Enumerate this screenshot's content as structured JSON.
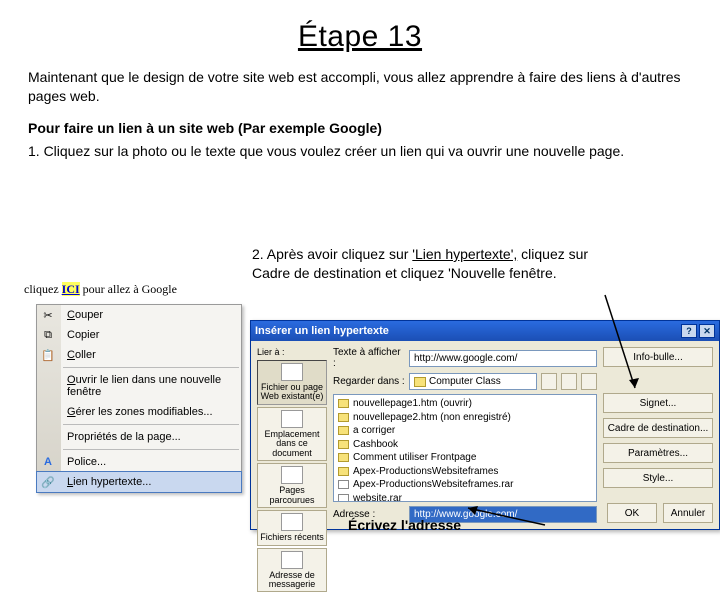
{
  "title": "Étape 13",
  "intro": "Maintenant que le design de votre site web est accompli, vous allez apprendre à faire des liens à d'autres pages web.",
  "subhead": "Pour faire un lien à un site web (Par exemple Google)",
  "step1": "1. Cliquez sur la photo ou le texte que vous voulez créer un lien qui va ouvrir une nouvelle page.",
  "step2_pre": "2. Après avoir cliquez sur ",
  "step2_link": "'Lien hypertexte',",
  "step2_post": " cliquez sur Cadre de destination et cliquez 'Nouvelle fenêtre.",
  "example_prefix": "cliquez ",
  "example_highlight": "ICI",
  "example_suffix": " pour allez à Google",
  "ctx": {
    "cut": [
      "C",
      "ouper"
    ],
    "copy": [
      "",
      "Copier"
    ],
    "paste": [
      "C",
      "oller"
    ],
    "newwin": [
      "O",
      "uvrir le lien dans une nouvelle fenêtre"
    ],
    "zones": [
      "G",
      "érer les zones modifiables..."
    ],
    "props": [
      "",
      "Propriétés de la page..."
    ],
    "font": [
      "",
      "Police..."
    ],
    "hyper": [
      "L",
      "ien hypertexte..."
    ]
  },
  "dlg": {
    "title": "Insérer un lien hypertexte",
    "text_label": "Texte à afficher :",
    "text_value": "http://www.google.com/",
    "look_label": "Regarder dans :",
    "look_value": "Computer Class",
    "addr_label": "Adresse :",
    "addr_value": "http://www.google.com/",
    "left": [
      "Fichier ou page Web existant(e)",
      "Emplacement dans ce document",
      "Pages parcourues",
      "Fichiers récents",
      "Adresse de messagerie"
    ],
    "list": [
      "nouvellepage1.htm (ouvrir)",
      "nouvellepage2.htm (non enregistré)",
      "a corriger",
      "Cashbook",
      "Comment utiliser Frontpage",
      "Apex-ProductionsWebsiteframes",
      "Apex-ProductionsWebsiteframes.rar",
      "website.rar"
    ],
    "right": {
      "info": "Info-bulle...",
      "signet": "Signet...",
      "cadre": "Cadre de destination...",
      "param": "Paramètres...",
      "style": "Style...",
      "ok": "OK",
      "cancel": "Annuler"
    },
    "lier": "Lier à :"
  },
  "annot_write": "Écrivez l'adresse"
}
